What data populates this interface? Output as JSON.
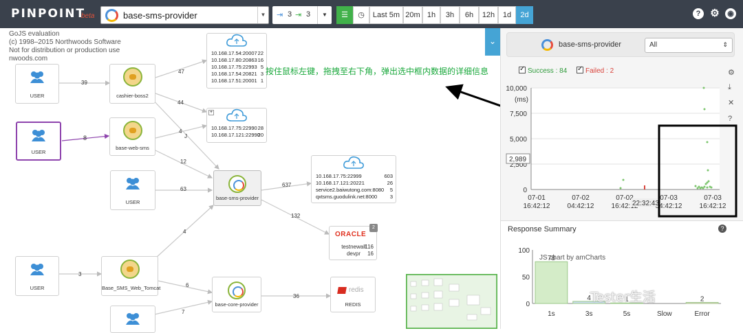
{
  "topbar": {
    "logo": "PINPOINT",
    "beta": "beta",
    "app_selected": "base-sms-provider",
    "depth_in": "3",
    "depth_out": "3",
    "time_buttons": [
      "Last 5m",
      "20m",
      "1h",
      "3h",
      "6h",
      "12h",
      "1d",
      "2d"
    ],
    "active_time": "2d",
    "icons": [
      "help-icon",
      "gear-icon",
      "github-icon"
    ]
  },
  "map": {
    "gojs_lines": [
      "GoJS evaluation",
      "(c) 1998–2015 Northwoods Software",
      "Not for distribution or production use",
      "nwoods.com"
    ],
    "annotation": "按住鼠标左键，拖拽至右下角，弹出选中框内数据的详细信息",
    "nodes": {
      "user1": "USER",
      "user2": "USER",
      "user3": "USER",
      "user4": "USER",
      "cashier": "cashier-boss2",
      "websms": "base-web-sms",
      "provider": "base-sms-provider",
      "smsweb": "Base_SMS_Web_Tomcat",
      "core": "base-core-provider",
      "redis_logo": "redis",
      "redis": "REDIS",
      "oracle_logo": "ORACLE",
      "oracle_badge": "2"
    },
    "cloud1": [
      {
        "host": "10.168.17.54:20007",
        "count": "22"
      },
      {
        "host": "10.168.17.80:20863",
        "count": "16"
      },
      {
        "host": "10.168.17.75:22993",
        "count": "5"
      },
      {
        "host": "10.168.17.54:20821",
        "count": "3"
      },
      {
        "host": "10.168.17.51:20001",
        "count": "1"
      }
    ],
    "cloud2": [
      {
        "host": "10.168.17.75:22990",
        "count": "28"
      },
      {
        "host": "10.168.17.121:22990",
        "count": "20"
      }
    ],
    "cloud3": [
      {
        "host": "10.168.17.75:22999",
        "count": "603"
      },
      {
        "host": "10.168.17.121:20221",
        "count": "26"
      },
      {
        "host": "service2.baiwutong.com:8080",
        "count": "5"
      },
      {
        "host": "qxtsms.guodulink.net:8000",
        "count": "3"
      }
    ],
    "oracle_rows": [
      {
        "name": "testnewall",
        "count": "116"
      },
      {
        "name": "devpr",
        "count": "16"
      }
    ],
    "edges": {
      "e39": "39",
      "e47": "47",
      "e44": "44",
      "e8": "8",
      "e4a": "4",
      "e12": "12",
      "e63": "63",
      "e637": "637",
      "e132": "132",
      "e4b": "4",
      "e3": "3",
      "e6": "6",
      "e36": "36",
      "e7": "7",
      "eJ": "J"
    }
  },
  "panel": {
    "app_name": "base-sms-provider",
    "filter_value": "All",
    "success_label": "Success : 84",
    "failed_label": "Failed : 2",
    "scatter": {
      "y_ticks": [
        "10,000",
        "7,500",
        "5,000",
        "2,500",
        "0"
      ],
      "y_unit": "(ms)",
      "marker": "2,989",
      "x_ticks": [
        [
          "07-01",
          "16:42:12"
        ],
        [
          "07-02",
          "04:42:12"
        ],
        [
          "07-02",
          "16:42:12"
        ],
        [
          "07-03",
          "04:42:12"
        ],
        [
          "07-03",
          "16:42:12"
        ]
      ],
      "overlay_time": "22:32:43"
    },
    "response_title": "Response Summary",
    "amcharts_credit": "JS chart by amCharts",
    "watermark": "Tester生活"
  },
  "chart_data": {
    "type": "bar",
    "title": "Response Summary",
    "categories": [
      "1s",
      "3s",
      "5s",
      "Slow",
      "Error"
    ],
    "values": [
      78,
      4,
      1,
      0,
      2
    ],
    "ylim": [
      0,
      100
    ],
    "y_ticks": [
      "0",
      "50",
      "100"
    ],
    "colors": {
      "1s": "#d4ecc8",
      "3s": "#c9dcef",
      "Error": "#f2c9c9"
    }
  }
}
